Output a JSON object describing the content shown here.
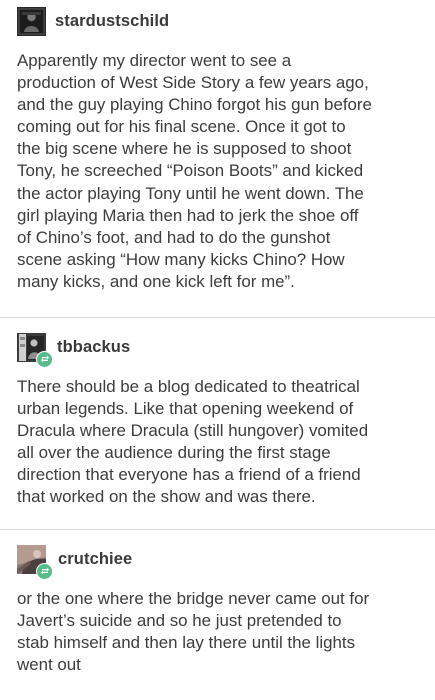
{
  "posts": [
    {
      "username": "stardustschild",
      "avatar": "stardustschild-avatar",
      "reblog": false,
      "lines": [
        "Apparently my director went to see a",
        "production of West Side Story a few years ago,",
        "and the guy playing Chino forgot his gun before",
        "coming out for his final scene. Once it got to",
        "the big scene where he is supposed to shoot",
        "Tony, he screeched “Poison Boots” and kicked",
        "the actor playing Tony until he went down. The",
        "girl playing Maria then had to jerk the shoe off",
        "of Chino’s foot, and had to do the gunshot",
        "scene asking “How many kicks Chino? How",
        "many kicks, and one kick left for me”."
      ]
    },
    {
      "username": "tbbackus",
      "avatar": "tbbackus-avatar",
      "reblog": true,
      "lines": [
        "There should be a blog dedicated to theatrical",
        "urban legends. Like that opening weekend of",
        "Dracula where Dracula (still hungover) vomited",
        "all over the audience during the first stage",
        "direction that everyone has a friend of a friend",
        "that worked on the show and was there."
      ]
    },
    {
      "username": "crutchiee",
      "avatar": "crutchiee-avatar",
      "reblog": true,
      "lines": [
        "or the one where the bridge never came out for",
        "Javert’s suicide and so he just pretended to",
        "stab himself and then lay there until the lights",
        "went out"
      ]
    }
  ],
  "colors": {
    "text": "#3c3c3c",
    "username": "#3a3a3a",
    "divider": "#d6d6d6",
    "reblog_badge": "#56bc8a"
  },
  "icons": {
    "reblog": "reblog-icon"
  }
}
